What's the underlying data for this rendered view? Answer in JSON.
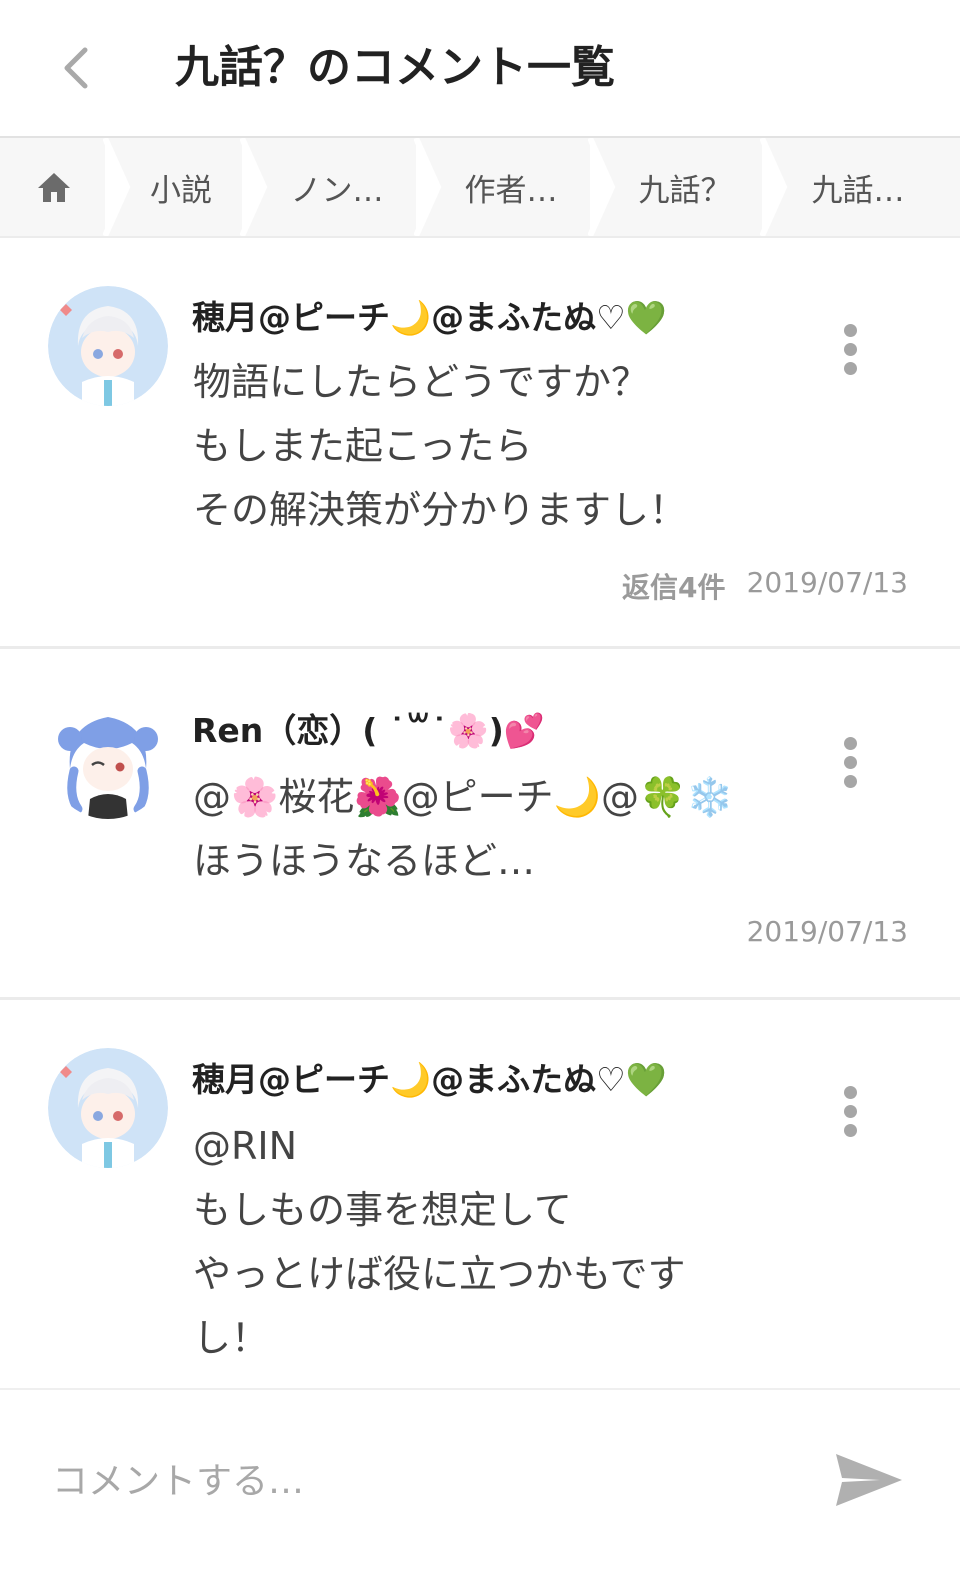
{
  "header": {
    "title": "九話？のコメント一覧",
    "back_icon": "chevron-left-icon"
  },
  "breadcrumb": {
    "home_icon": "home-icon",
    "items": [
      {
        "label": "小説"
      },
      {
        "label": "ノン…"
      },
      {
        "label": "作者…"
      },
      {
        "label": "九話？"
      },
      {
        "label": "九話…"
      }
    ]
  },
  "comments": [
    {
      "user": "穂月@ピーチ🌙@まふたぬ♡💚",
      "text": "物語にしたらどうですか？\nもしまた起こったら\nその解決策が分かりますし！",
      "reply_count": "返信4件",
      "date": "2019/07/13"
    },
    {
      "user": "Ren（恋）( ˙꒳˙🌸)💕",
      "text": "@🌸桜花🌺@ピーチ🌙@🍀❄️\nほうほうなるほど…",
      "date": "2019/07/13"
    },
    {
      "user": "穂月@ピーチ🌙@まふたぬ♡💚",
      "text": "@RIN\nもしもの事を想定して\nやっとけば役に立つかもです\nし！"
    }
  ],
  "composer": {
    "placeholder": "コメントする…",
    "send_icon": "send-icon"
  },
  "colors": {
    "breadcrumb_bg": "#f7f7f7",
    "text_primary": "#222222",
    "text_muted": "#9a9a9a",
    "icon_gray": "#a6a6a6"
  }
}
